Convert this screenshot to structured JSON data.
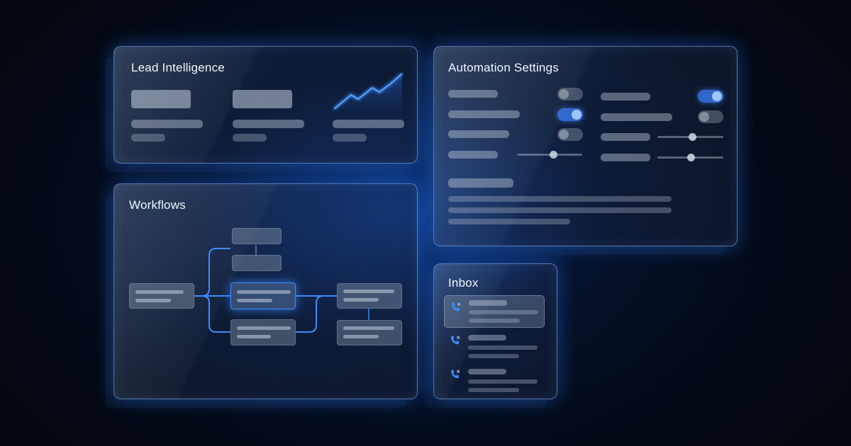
{
  "panels": {
    "lead_intelligence": {
      "title": "Lead Intelligence"
    },
    "automation_settings": {
      "title": "Automation Settings",
      "toggles": {
        "left_row1": false,
        "left_row2": true,
        "left_row3": false,
        "right_row1": true,
        "right_row2": false
      }
    },
    "workflows": {
      "title": "Workflows"
    },
    "inbox": {
      "title": "Inbox"
    }
  },
  "colors": {
    "accent": "#3e8dff",
    "panel_border": "#96beff",
    "background": "#030812"
  },
  "icons": {
    "trend": "trend-up-icon",
    "call": "missed-call-icon"
  }
}
